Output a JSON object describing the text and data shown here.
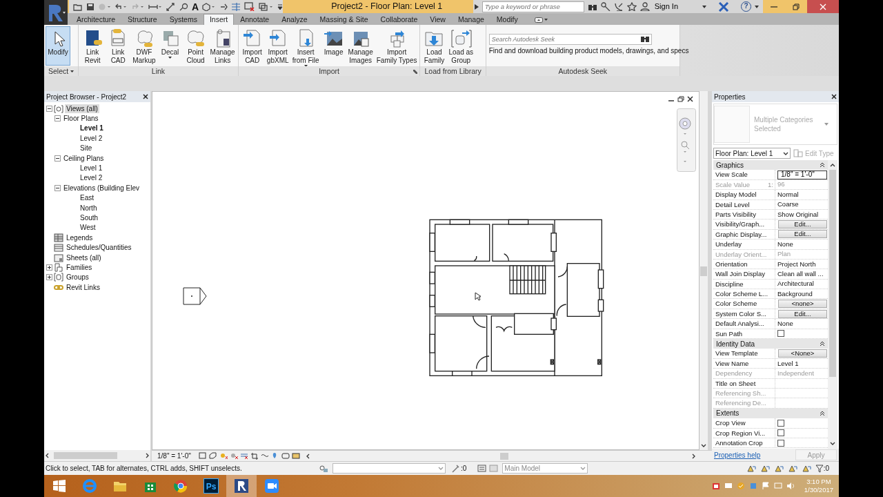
{
  "window": {
    "title": "Project2 - Floor Plan: Level 1",
    "text_tool": "A",
    "search": {
      "placeholder": "Type a keyword or phrase"
    },
    "sign_in": "Sign In",
    "help": "?"
  },
  "tabs": [
    {
      "label": "Architecture",
      "selected": false
    },
    {
      "label": "Structure",
      "selected": false
    },
    {
      "label": "Systems",
      "selected": false
    },
    {
      "label": "Insert",
      "selected": true
    },
    {
      "label": "Annotate",
      "selected": false
    },
    {
      "label": "Analyze",
      "selected": false
    },
    {
      "label": "Massing & Site",
      "selected": false
    },
    {
      "label": "Collaborate",
      "selected": false
    },
    {
      "label": "View",
      "selected": false
    },
    {
      "label": "Manage",
      "selected": false
    },
    {
      "label": "Modify",
      "selected": false
    }
  ],
  "ribbon": [
    {
      "label": "Select",
      "kind": "buttons",
      "dropdown": true,
      "buttons": [
        {
          "lines": [
            "Modify"
          ],
          "selected": true,
          "dropdown": false
        }
      ]
    },
    {
      "label": "Link",
      "kind": "buttons",
      "dropdown": false,
      "buttons": [
        {
          "lines": [
            "Link",
            "Revit"
          ],
          "selected": false,
          "dropdown": false
        },
        {
          "lines": [
            "Link",
            "CAD"
          ],
          "selected": false,
          "dropdown": false
        },
        {
          "lines": [
            "DWF",
            "Markup"
          ],
          "selected": false,
          "dropdown": false
        },
        {
          "lines": [
            "Decal"
          ],
          "selected": false,
          "dropdown": true
        },
        {
          "lines": [
            "Point",
            "Cloud"
          ],
          "selected": false,
          "dropdown": false
        },
        {
          "lines": [
            "Manage",
            "Links"
          ],
          "selected": false,
          "dropdown": false
        }
      ]
    },
    {
      "label": "Import",
      "kind": "buttons",
      "dropdown": false,
      "buttons": [
        {
          "lines": [
            "Import",
            "CAD"
          ],
          "selected": false,
          "dropdown": false
        },
        {
          "lines": [
            "Import",
            "gbXML"
          ],
          "selected": false,
          "dropdown": false
        },
        {
          "lines": [
            "Insert",
            "from File"
          ],
          "selected": false,
          "dropdown": true
        },
        {
          "lines": [
            "Image"
          ],
          "selected": false,
          "dropdown": false
        },
        {
          "lines": [
            "Manage",
            "Images"
          ],
          "selected": false,
          "dropdown": false
        },
        {
          "lines": [
            "Import",
            "Family Types"
          ],
          "selected": false,
          "dropdown": false
        }
      ]
    },
    {
      "label": "Load from Library",
      "kind": "buttons",
      "dropdown": false,
      "buttons": [
        {
          "lines": [
            "Load",
            "Family"
          ],
          "selected": false,
          "dropdown": false
        },
        {
          "lines": [
            "Load as",
            "Group"
          ],
          "selected": false,
          "dropdown": false
        }
      ]
    },
    {
      "label": "Autodesk Seek",
      "kind": "seek",
      "dropdown": false,
      "placeholder": "Search Autodesk Seek",
      "text": "Find and download building product models, drawings, and specs"
    }
  ],
  "project_browser": {
    "title": "Project Browser - Project2",
    "tree": [
      {
        "label": "Views (all)",
        "selected": true,
        "bold": false,
        "expanded": true,
        "children": [
          {
            "label": "Floor Plans",
            "selected": false,
            "bold": false,
            "expanded": true,
            "children": [
              {
                "label": "Level 1",
                "selected": false,
                "bold": true
              },
              {
                "label": "Level 2",
                "selected": false,
                "bold": false
              },
              {
                "label": "Site",
                "selected": false,
                "bold": false
              }
            ]
          },
          {
            "label": "Ceiling Plans",
            "selected": false,
            "bold": false,
            "expanded": true,
            "children": [
              {
                "label": "Level 1",
                "selected": false,
                "bold": false
              },
              {
                "label": "Level 2",
                "selected": false,
                "bold": false
              }
            ]
          },
          {
            "label": "Elevations (Building Elev",
            "selected": false,
            "bold": false,
            "expanded": true,
            "children": [
              {
                "label": "East",
                "selected": false,
                "bold": false
              },
              {
                "label": "North",
                "selected": false,
                "bold": false
              },
              {
                "label": "South",
                "selected": false,
                "bold": false
              },
              {
                "label": "West",
                "selected": false,
                "bold": false
              }
            ]
          }
        ]
      },
      {
        "label": "Legends",
        "selected": false,
        "bold": false
      },
      {
        "label": "Schedules/Quantities",
        "selected": false,
        "bold": false
      },
      {
        "label": "Sheets (all)",
        "selected": false,
        "bold": false
      },
      {
        "label": "Families",
        "selected": false,
        "bold": false,
        "expanded": false
      },
      {
        "label": "Groups",
        "selected": false,
        "bold": false,
        "expanded": false
      },
      {
        "label": "Revit Links",
        "selected": false,
        "bold": false
      }
    ]
  },
  "view_bar": {
    "scale": "1/8\" = 1'-0\""
  },
  "properties": {
    "title": "Properties",
    "preview_text": "Multiple Categories Selected",
    "type_selector": "Floor Plan: Level 1",
    "edit_type": {
      "label": "Edit Type",
      "disabled": true
    },
    "groups": [
      {
        "label": "Graphics",
        "rows": [
          {
            "label": "View Scale",
            "kind": "input",
            "value": "1/8\" = 1'-0\"",
            "disabled": false
          },
          {
            "label": "Scale Value",
            "suffix": "1:",
            "kind": "text",
            "value": "96",
            "disabled": true
          },
          {
            "label": "Display Model",
            "kind": "text",
            "value": "Normal",
            "disabled": false
          },
          {
            "label": "Detail Level",
            "kind": "text",
            "value": "Coarse",
            "disabled": false
          },
          {
            "label": "Parts Visibility",
            "kind": "text",
            "value": "Show Original",
            "disabled": false
          },
          {
            "label": "Visibility/Graph...",
            "kind": "button",
            "value": "Edit...",
            "disabled": false
          },
          {
            "label": "Graphic Display...",
            "kind": "button",
            "value": "Edit...",
            "disabled": false
          },
          {
            "label": "Underlay",
            "kind": "text",
            "value": "None",
            "disabled": false
          },
          {
            "label": "Underlay Orient...",
            "kind": "text",
            "value": "Plan",
            "disabled": true
          },
          {
            "label": "Orientation",
            "kind": "text",
            "value": "Project North",
            "disabled": false
          },
          {
            "label": "Wall Join Display",
            "kind": "text",
            "value": "Clean all wall ...",
            "disabled": false
          },
          {
            "label": "Discipline",
            "kind": "text",
            "value": "Architectural",
            "disabled": false
          },
          {
            "label": "Color Scheme L...",
            "kind": "text",
            "value": "Background",
            "disabled": false
          },
          {
            "label": "Color Scheme",
            "kind": "button",
            "value": "<none>",
            "disabled": false
          },
          {
            "label": "System Color S...",
            "kind": "button",
            "value": "Edit...",
            "disabled": false
          },
          {
            "label": "Default Analysi...",
            "kind": "text",
            "value": "None",
            "disabled": false
          },
          {
            "label": "Sun Path",
            "kind": "checkbox",
            "checked": false,
            "disabled": false
          }
        ]
      },
      {
        "label": "Identity Data",
        "rows": [
          {
            "label": "View Template",
            "kind": "button",
            "value": "<None>",
            "disabled": false
          },
          {
            "label": "View Name",
            "kind": "text",
            "value": "Level 1",
            "disabled": false
          },
          {
            "label": "Dependency",
            "kind": "text",
            "value": "Independent",
            "disabled": true
          },
          {
            "label": "Title on Sheet",
            "kind": "text",
            "disabled": false
          },
          {
            "label": "Referencing Sh...",
            "kind": "text",
            "disabled": true
          },
          {
            "label": "Referencing De...",
            "kind": "text",
            "disabled": true
          }
        ]
      },
      {
        "label": "Extents",
        "rows": [
          {
            "label": "Crop View",
            "kind": "checkbox",
            "checked": false,
            "disabled": false
          },
          {
            "label": "Crop Region Vi...",
            "kind": "checkbox",
            "checked": false,
            "disabled": false
          },
          {
            "label": "Annotation Crop",
            "kind": "checkbox",
            "checked": false,
            "disabled": false
          }
        ]
      }
    ],
    "help_link": "Properties help",
    "apply": {
      "label": "Apply",
      "disabled": true
    }
  },
  "status_bar": {
    "message": "Click to select, TAB for alternates, CTRL adds, SHIFT unselects.",
    "selection_count": ":0",
    "model": "Main Model",
    "filter_count": ":0"
  },
  "taskbar": {
    "time": "3:10 PM",
    "date": "1/30/2017",
    "apps": [
      {
        "selected": false
      },
      {
        "selected": false
      },
      {
        "selected": false
      },
      {
        "selected": false
      },
      {
        "selected": false,
        "text": "Ps"
      },
      {
        "selected": true
      },
      {
        "selected": false
      }
    ]
  }
}
